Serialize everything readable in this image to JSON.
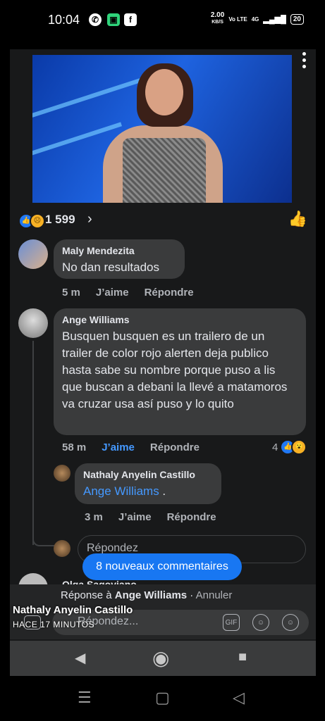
{
  "status": {
    "time": "10:04",
    "speed": "2.00",
    "speed_unit": "KB/S",
    "volte": "Vo LTE",
    "network": "4G",
    "battery": "20"
  },
  "reactions": {
    "count": "1 599"
  },
  "comments": [
    {
      "author": "Maly Mendezita",
      "text": "No dan resultados",
      "time": "5 m",
      "like": "J’aime",
      "reply": "Répondre"
    },
    {
      "author": "Ange Williams",
      "text": "Busquen  busquen  es un trailero de un trailer de color rojo alerten  deja publico hasta sabe  su nombre porque puso a lis que buscan a debani  la llevé a matamoros  va cruzar usa así puso y lo quito",
      "time": "58 m",
      "like": "J’aime",
      "reply": "Répondre",
      "reaction_count": "4"
    }
  ],
  "reply_comment": {
    "author": "Nathaly Anyelin Castillo",
    "mention": "Ange Williams",
    "suffix": " .",
    "time": "3 m",
    "like": "J’aime",
    "reply": "Répondre"
  },
  "reply_box": {
    "placeholder": "Répondez"
  },
  "new_comments_pill": "8 nouveaux commentaires",
  "partial_author": "Olga Sagoviano",
  "replying_to": {
    "prefix": "Réponse à ",
    "name": "Ange Williams",
    "sep": " · ",
    "cancel": "Annuler"
  },
  "composer": {
    "placeholder": "Répondez...",
    "gif": "GIF"
  },
  "overlay": {
    "name": "Nathaly Anyelin Castillo",
    "time": "HACE 17 MINUTOS"
  }
}
